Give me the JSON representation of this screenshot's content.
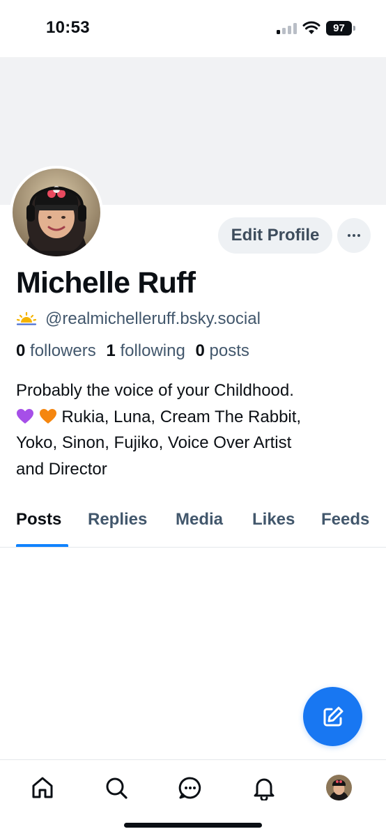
{
  "status_bar": {
    "time": "10:53",
    "battery": "97",
    "signal_bars_active": 1,
    "signal_bars_total": 4
  },
  "profile": {
    "display_name": "Michelle Ruff",
    "handle": "@realmichelleruff.bsky.social",
    "handle_icon": "sunrise-icon",
    "edit_label": "Edit Profile",
    "more_label": "···",
    "stats": {
      "followers_count": "0",
      "followers_label": "followers",
      "following_count": "1",
      "following_label": "following",
      "posts_count": "0",
      "posts_label": "posts"
    },
    "bio": {
      "line1": "Probably the voice of your Childhood.",
      "line2_text": "Rukia, Luna, Cream The Rabbit,",
      "line2_emoji": [
        "purple-heart-icon",
        "orange-heart-icon"
      ],
      "line3": "Yoko, Sinon, Fujiko, Voice Over Artist",
      "line4": "and Director"
    }
  },
  "tabs": [
    {
      "label": "Posts",
      "active": true
    },
    {
      "label": "Replies",
      "active": false
    },
    {
      "label": "Media",
      "active": false
    },
    {
      "label": "Likes",
      "active": false
    },
    {
      "label": "Feeds",
      "active": false
    }
  ],
  "bottom_nav": [
    "home-icon",
    "search-icon",
    "chat-icon",
    "bell-icon",
    "profile-avatar"
  ],
  "colors": {
    "accent": "#1083fe",
    "fab": "#1877f2",
    "muted_text": "#42576c",
    "banner": "#f1f2f4",
    "button_bg": "#eef1f4"
  }
}
